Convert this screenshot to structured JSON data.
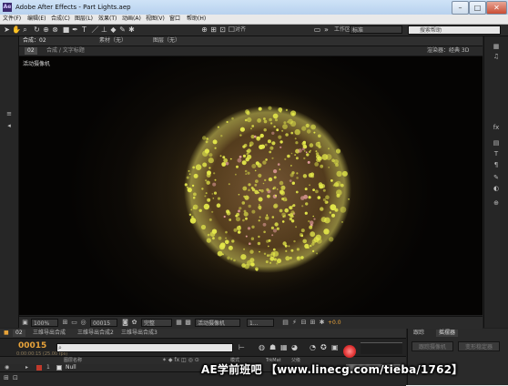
{
  "window": {
    "app_icon": "Ae",
    "title": "Adobe After Effects - Part Lights.aep",
    "minimize": "–",
    "maximize": "□",
    "close": "✕"
  },
  "menu": [
    "文件(F)",
    "编辑(E)",
    "合成(C)",
    "图层(L)",
    "效果(T)",
    "动画(A)",
    "视图(V)",
    "窗口",
    "帮助(H)"
  ],
  "toolbar": {
    "snap_label": "对齐",
    "workspace_label": "工作区：",
    "workspace_value": "标准",
    "search_placeholder": "搜索帮助"
  },
  "comp_panel": {
    "tabs": [
      "合成：02",
      "素材（无）",
      "图层（无）"
    ],
    "breadcrumb": "02",
    "breadcrumb_sub": "合成 / 文字标题",
    "renderer_label": "渲染器：经典 3D",
    "camera_label": "活动摄像机"
  },
  "viewer_controls": {
    "zoom": "100%",
    "timecode": "00015",
    "resolution": "完整",
    "view": "活动摄像机",
    "views_count": "1...",
    "exposure": "+0.0"
  },
  "timeline": {
    "tabs": [
      "02",
      "三维导出合成",
      "三维导出合成2",
      "三维导出合成3"
    ],
    "current_time": "00015",
    "fps": "0:00:00:15 (25.00 fps)",
    "header_label": "图层名称",
    "mode_label": "模式",
    "trkmat_label": "TrkMat",
    "parent_label": "父级",
    "layer_num": "1",
    "layer_name": "Null"
  },
  "right_dock": {
    "tabs": [
      "跟踪",
      "摇摆器"
    ],
    "btn1": "跟踪摄像机",
    "btn2": "变形稳定器"
  },
  "watermark": "AE学前班吧 【www.linecg.com/tieba/1762】",
  "colors": {
    "timecode": "#e8a33a",
    "particles": "#e4e84a",
    "cursor": "#e03030"
  }
}
